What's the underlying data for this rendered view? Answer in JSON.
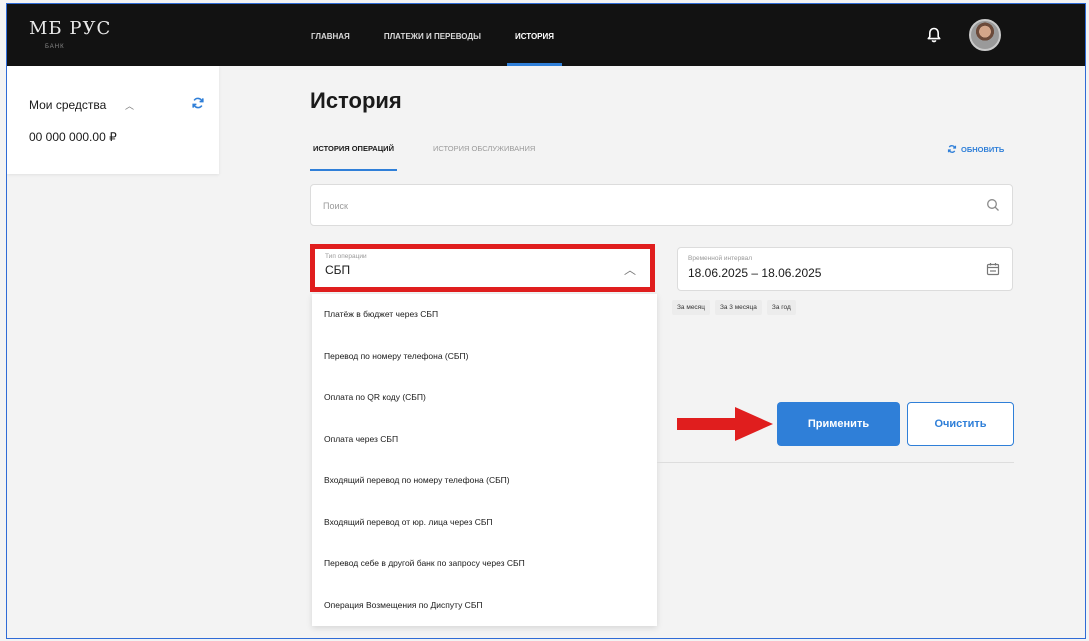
{
  "header": {
    "logo": "МБ РУС",
    "logo_sub": "БАНК",
    "nav": [
      {
        "label": "ГЛАВНАЯ",
        "active": false
      },
      {
        "label": "ПЛАТЕЖИ И ПЕРЕВОДЫ",
        "active": false
      },
      {
        "label": "ИСТОРИЯ",
        "active": true
      }
    ],
    "icons": {
      "bell": "bell-icon",
      "avatar": "user-avatar"
    }
  },
  "sidebar": {
    "title": "Мои средства",
    "amount": "00 000 000.00 ₽",
    "icons": {
      "caret": "chevron-up-icon",
      "refresh": "refresh-icon"
    }
  },
  "main": {
    "title": "История",
    "tabs": [
      {
        "label": "ИСТОРИЯ ОПЕРАЦИЙ",
        "active": true
      },
      {
        "label": "ИСТОРИЯ ОБСЛУЖИВАНИЯ",
        "active": false
      }
    ],
    "refresh_label": "ОБНОВИТЬ",
    "search": {
      "placeholder": "Поиск",
      "value": ""
    },
    "operation_type": {
      "label": "Тип операции",
      "value": "СБП",
      "options": [
        "Платёж в бюджет через СБП",
        "Перевод по номеру телефона (СБП)",
        "Оплата по QR коду (СБП)",
        "Оплата через СБП",
        "Входящий перевод по номеру телефона (СБП)",
        "Входящий перевод от юр. лица через СБП",
        "Перевод себе в другой банк по запросу через СБП",
        "Операция Возмещения по Диспуту СБП"
      ]
    },
    "period": {
      "label": "Временной интервал",
      "value": "18.06.2025 – 18.06.2025",
      "chips": [
        "За месяц",
        "За 3 месяца",
        "За год"
      ]
    },
    "apply_label": "Применить",
    "clear_label": "Очистить"
  },
  "colors": {
    "accent": "#2f7fd8",
    "highlight": "#e01e1e",
    "topbar": "#121212"
  }
}
